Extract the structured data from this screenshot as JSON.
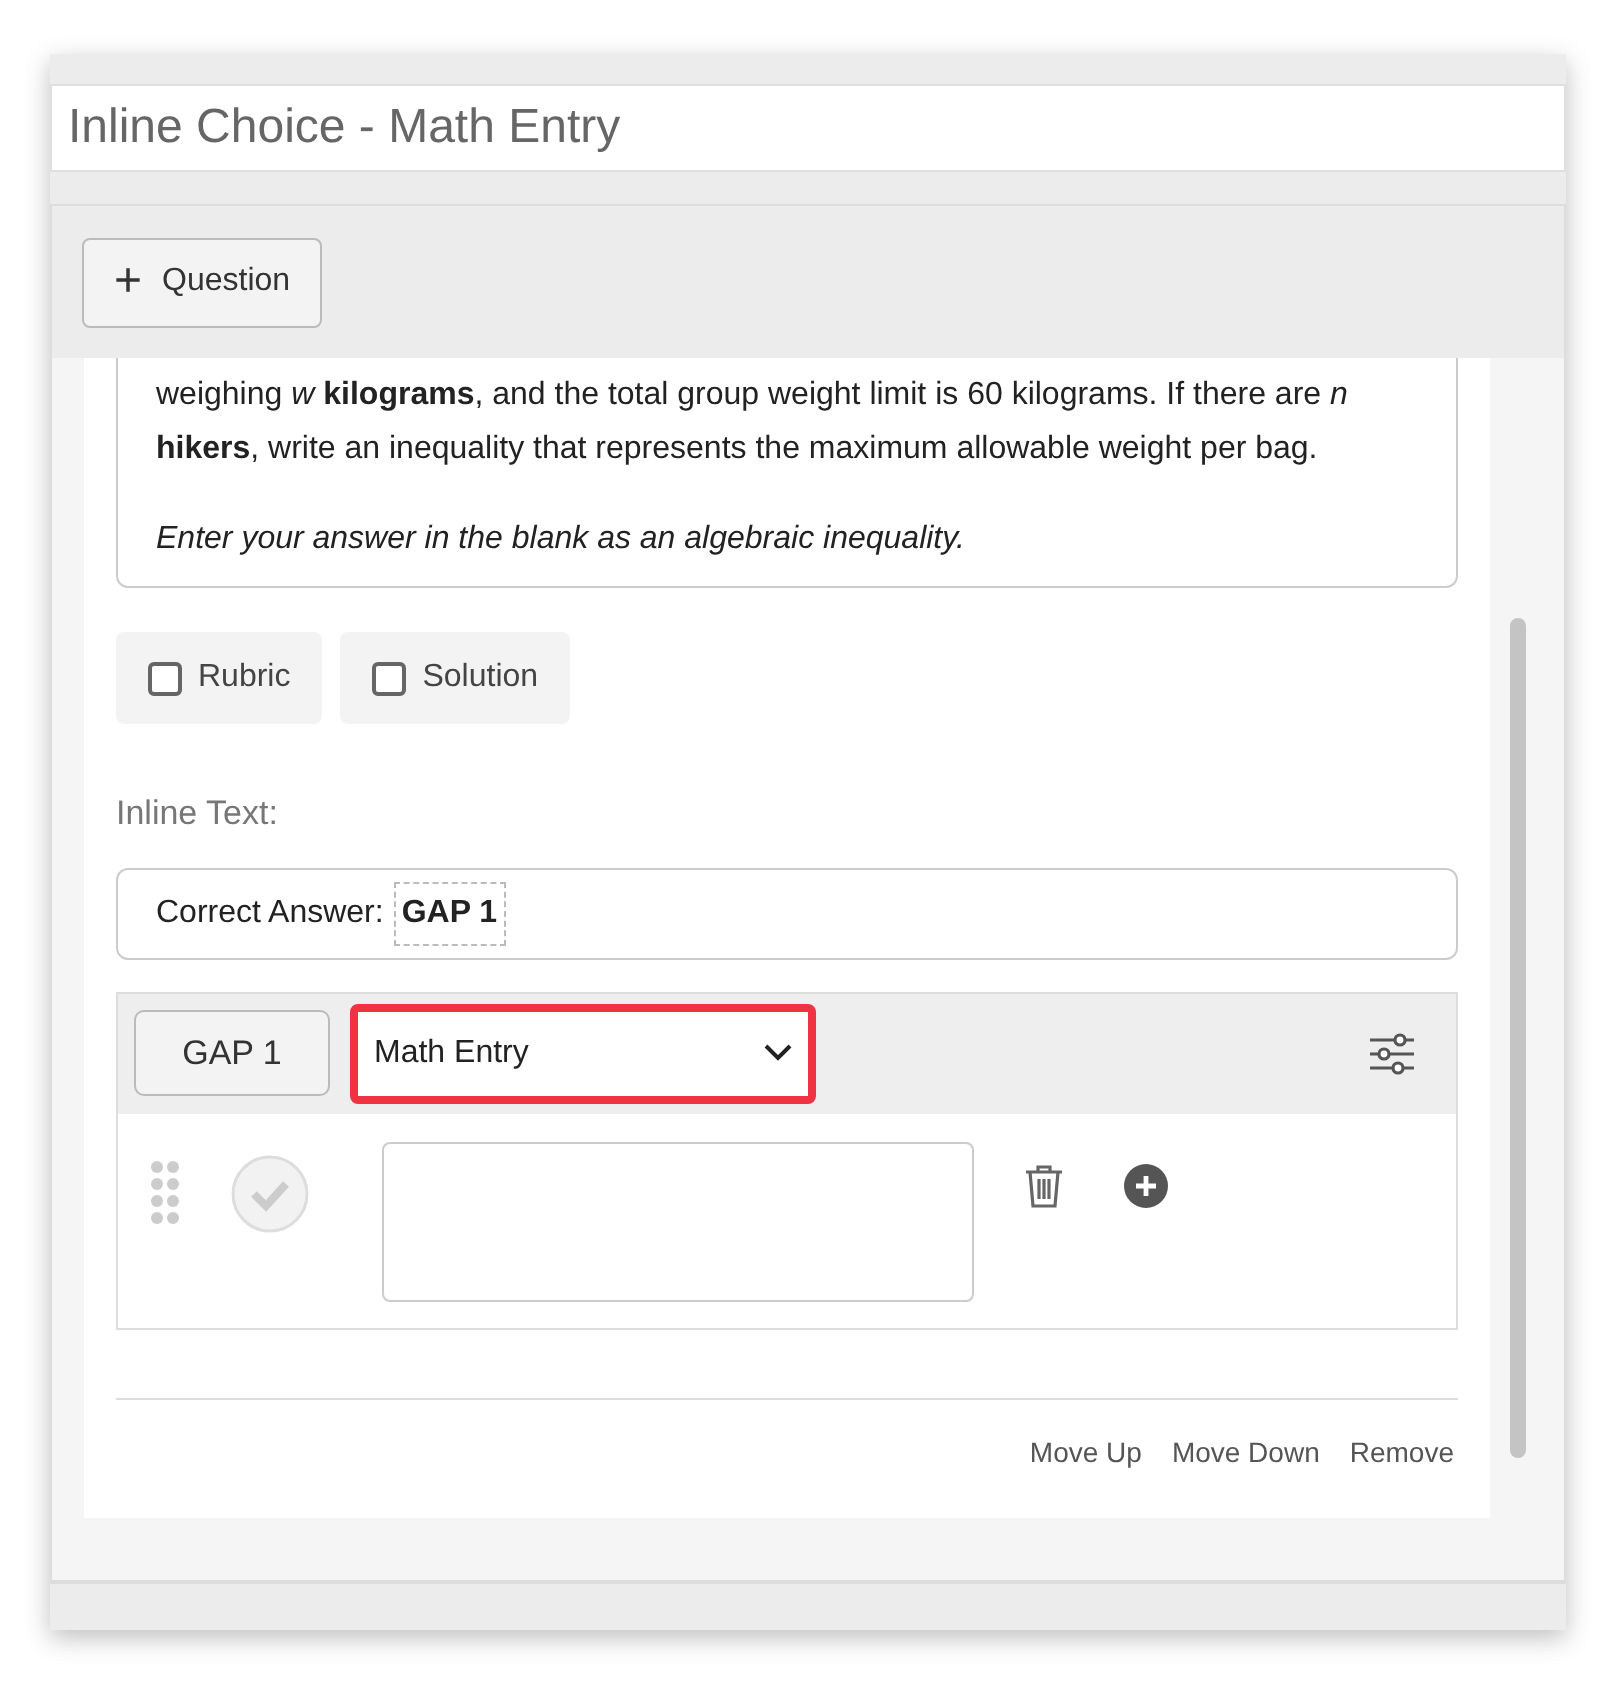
{
  "window": {
    "title": "Inline Choice - Math Entry"
  },
  "toolbar": {
    "add_button": {
      "icon": "+",
      "label": "Question"
    }
  },
  "question": {
    "paragraphs": [
      {
        "kind": "normal",
        "text": "weighing *w* **kilograms**, and the total group weight limit is 60 kilograms. If there are *n* **hikers**, write an inequality that represents the maximum allowable weight per bag."
      },
      {
        "kind": "instruction",
        "text": "Enter your answer in the blank as an algebraic inequality."
      }
    ]
  },
  "options": [
    {
      "label": "Rubric",
      "checked": false
    },
    {
      "label": "Solution",
      "checked": false
    }
  ],
  "inline_text": {
    "label": "Inline Text:",
    "prefix": "Correct Answer:",
    "gap": "GAP 1"
  },
  "gap_panel": {
    "gap_button": "GAP 1",
    "type_select": {
      "value": "Math Entry",
      "highlighted": true
    }
  },
  "actions": [
    "Move Up",
    "Move Down",
    "Remove"
  ]
}
